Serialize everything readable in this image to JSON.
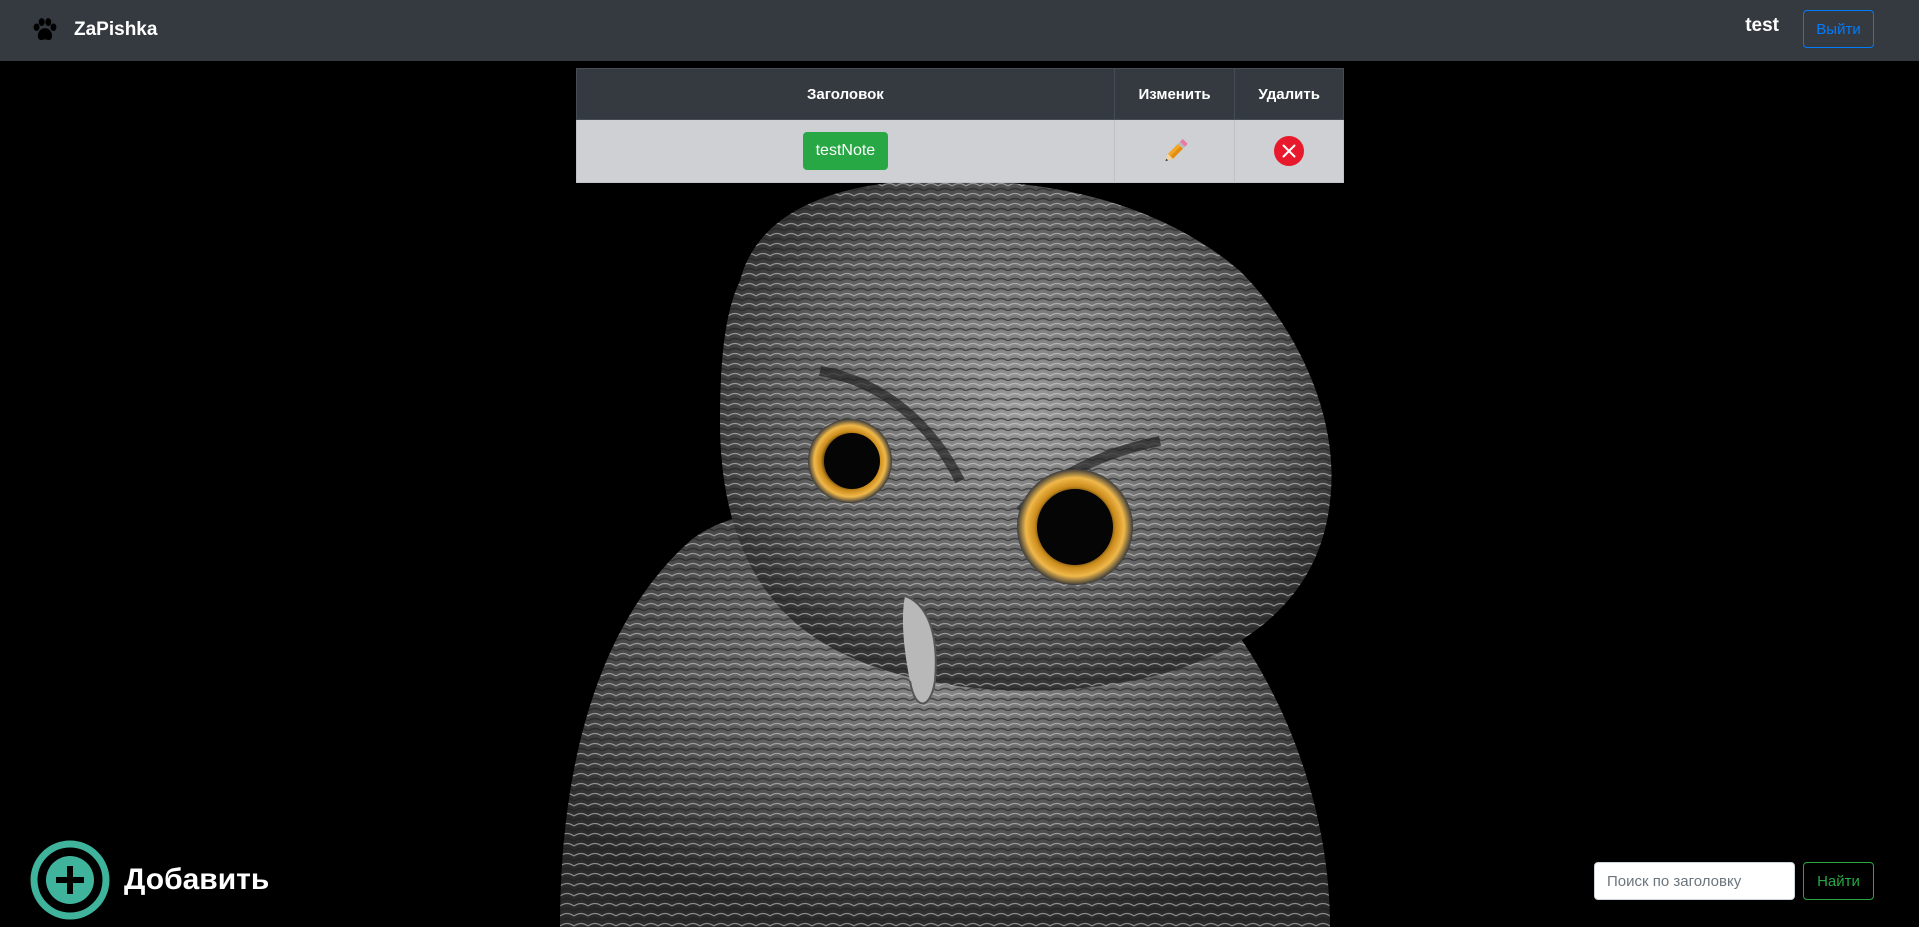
{
  "navbar": {
    "brand": "ZaPishka",
    "username": "test",
    "logout_label": "Выйти",
    "brand_icon": "paw-icon"
  },
  "background": {
    "image": "owl-photo"
  },
  "table": {
    "headers": [
      "Заголовок",
      "Изменить",
      "Удалить"
    ],
    "rows": [
      {
        "title": "testNote",
        "edit_icon": "pencil-icon",
        "delete_icon": "close-circle-icon"
      }
    ]
  },
  "add": {
    "label": "Добавить",
    "icon": "plus-circle-icon",
    "color": "#3fb39c"
  },
  "search": {
    "placeholder": "Поиск по заголовку",
    "value": "",
    "button_label": "Найти"
  },
  "colors": {
    "navbar": "#343a40",
    "primary": "#007bff",
    "success": "#28a745",
    "danger": "#e8192c"
  }
}
